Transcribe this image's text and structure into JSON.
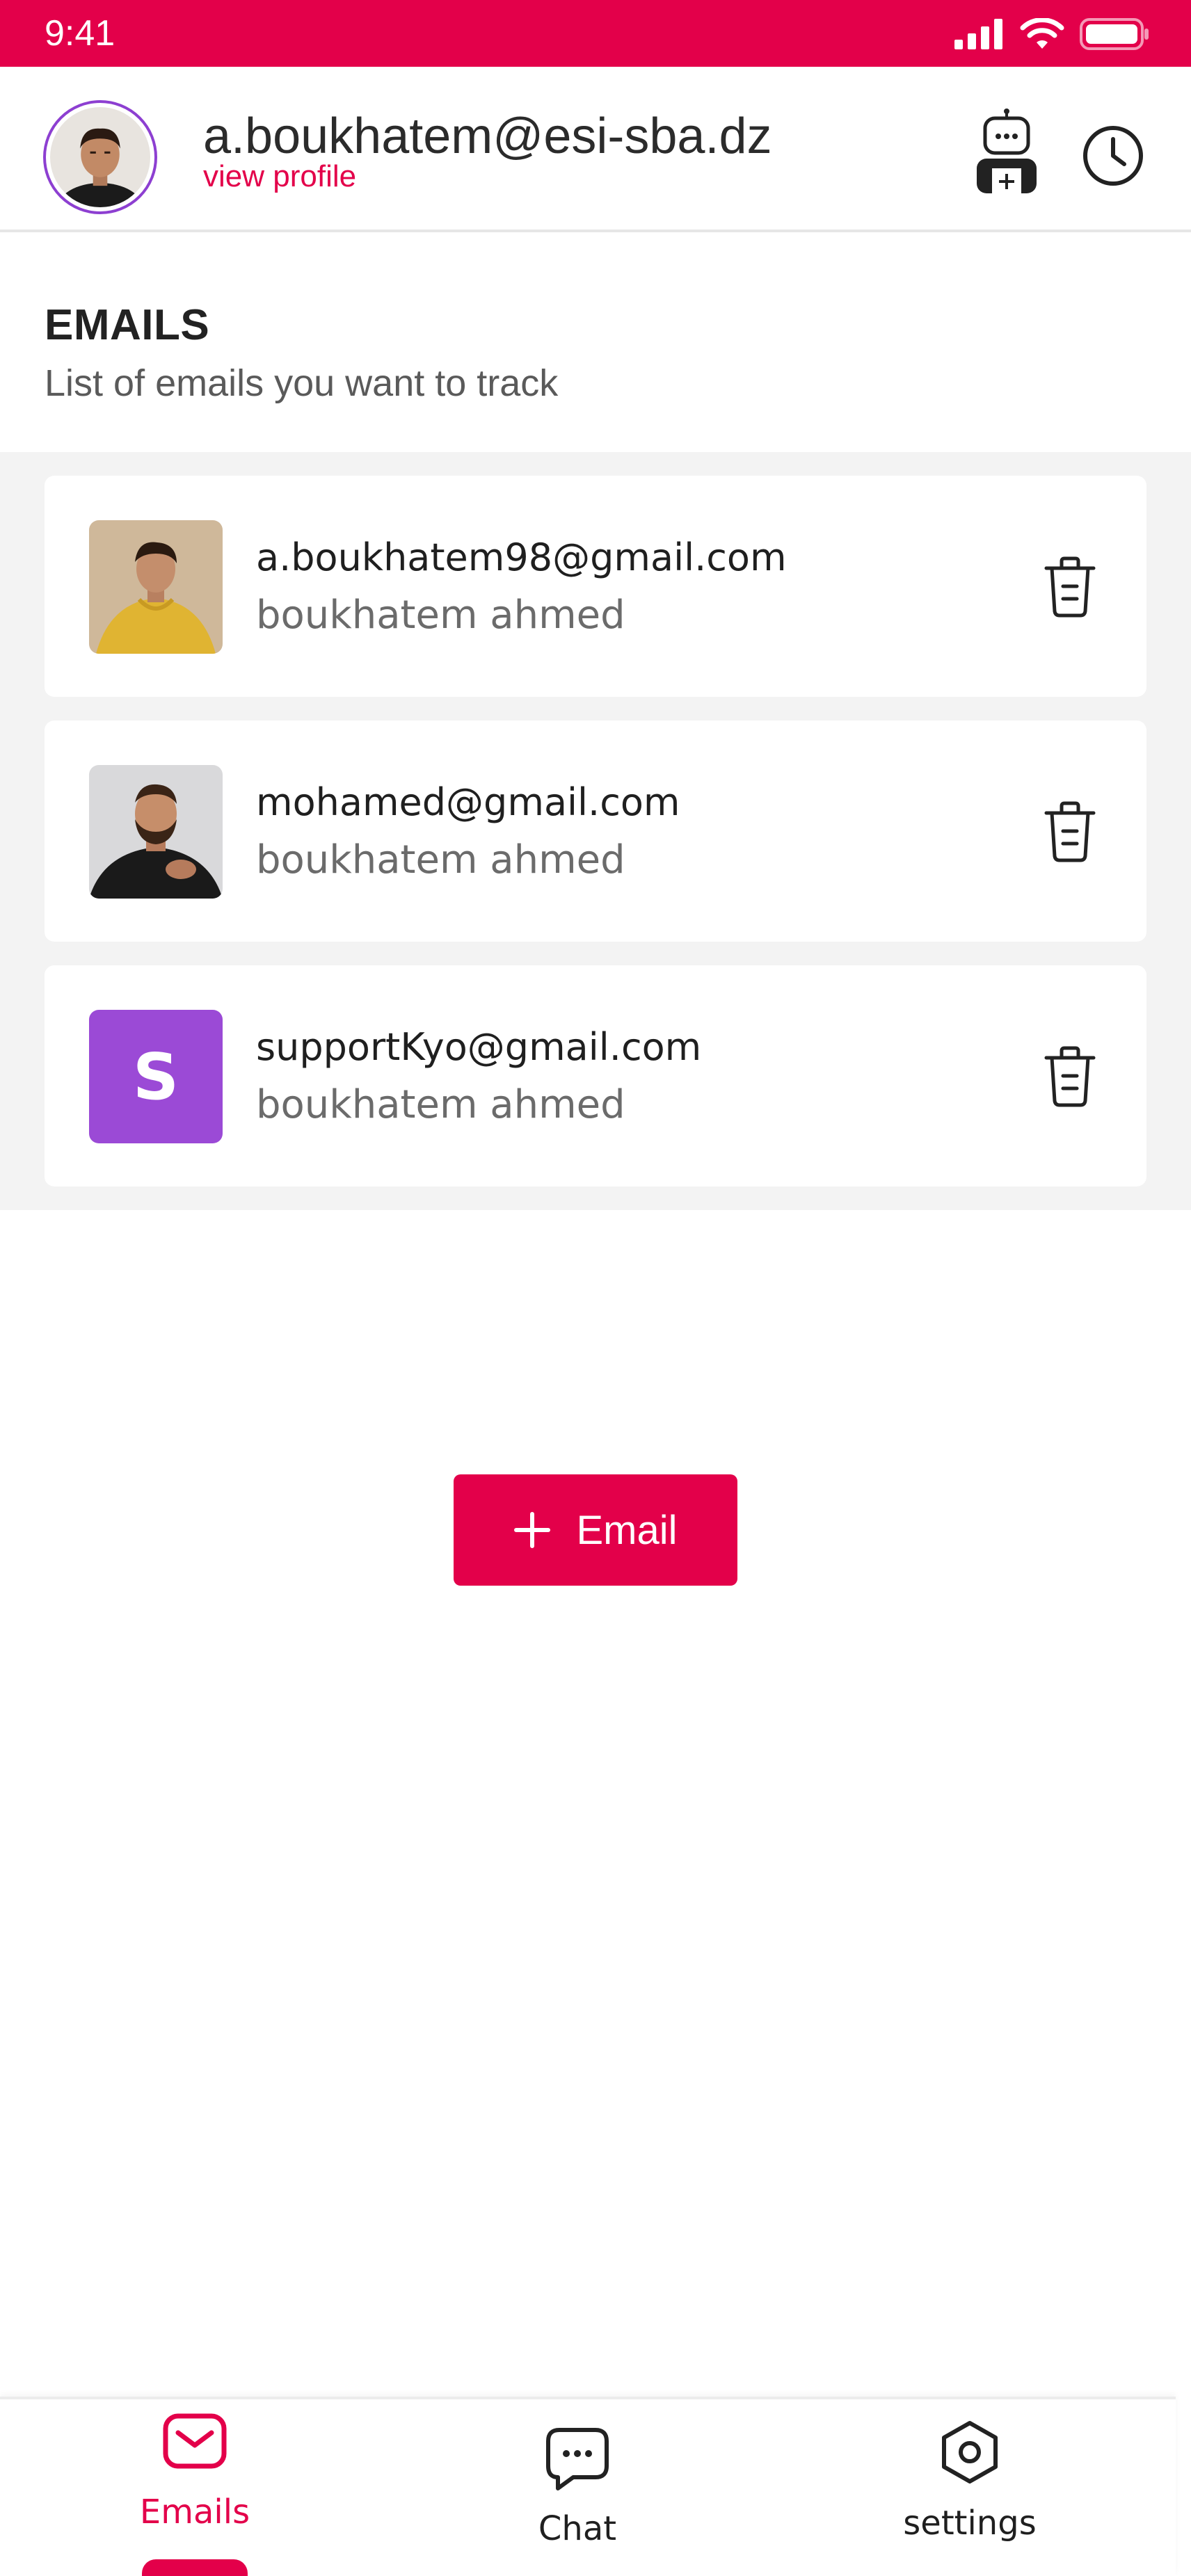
{
  "status_bar": {
    "time": "9:41"
  },
  "header": {
    "email": "a.boukhatem@esi-sba.dz",
    "view_profile": "view profile"
  },
  "section": {
    "title": "EMAILS",
    "subtitle": "List of emails you want to track"
  },
  "emails": [
    {
      "email": "a.boukhatem98@gmail.com",
      "name": "boukhatem ahmed"
    },
    {
      "email": "mohamed@gmail.com",
      "name": "boukhatem ahmed"
    },
    {
      "email": "supportKyo@gmail.com",
      "name": "boukhatem ahmed",
      "initial": "S"
    }
  ],
  "add_button": {
    "label": "Email"
  },
  "bottom_nav": {
    "items": [
      {
        "label": "Emails",
        "icon": "mail-icon",
        "active": true
      },
      {
        "label": "Chat",
        "icon": "chat-icon",
        "active": false
      },
      {
        "label": "settings",
        "icon": "settings-icon",
        "active": false
      }
    ]
  },
  "colors": {
    "accent": "#E3004A",
    "avatar_purple": "#9b4ad6",
    "background_list": "#f3f3f3"
  }
}
